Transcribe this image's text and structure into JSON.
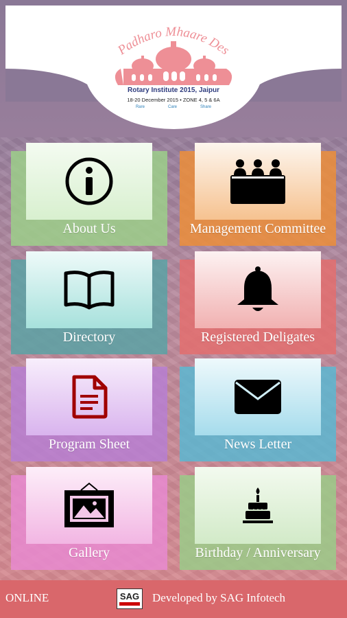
{
  "header": {
    "logo": {
      "arc_text": "Padharo Mhaare Des",
      "line1": "Rotary Institute 2015, Jaipur",
      "line2": "18-20 December 2015 • ZONE 4, 5 & 6A",
      "tags": [
        "Rare",
        "Care",
        "Share"
      ]
    }
  },
  "tiles": [
    {
      "label": "About Us",
      "icon": "info-icon"
    },
    {
      "label": "Management Committee",
      "icon": "committee-icon"
    },
    {
      "label": "Directory",
      "icon": "book-icon"
    },
    {
      "label": "Registered Deligates",
      "icon": "bell-icon"
    },
    {
      "label": "Program Sheet",
      "icon": "document-icon"
    },
    {
      "label": "News Letter",
      "icon": "envelope-icon"
    },
    {
      "label": "Gallery",
      "icon": "picture-frame-icon"
    },
    {
      "label": "Birthday / Anniversary",
      "icon": "birthday-cake-icon"
    }
  ],
  "footer": {
    "status": "ONLINE",
    "sag_logo_text": "SAG",
    "developer": "Developed by SAG Infotech"
  },
  "colors": {
    "footer": "#d9676b",
    "logo_pink": "#ee8f96",
    "logo_blue": "#2f3c7e"
  }
}
